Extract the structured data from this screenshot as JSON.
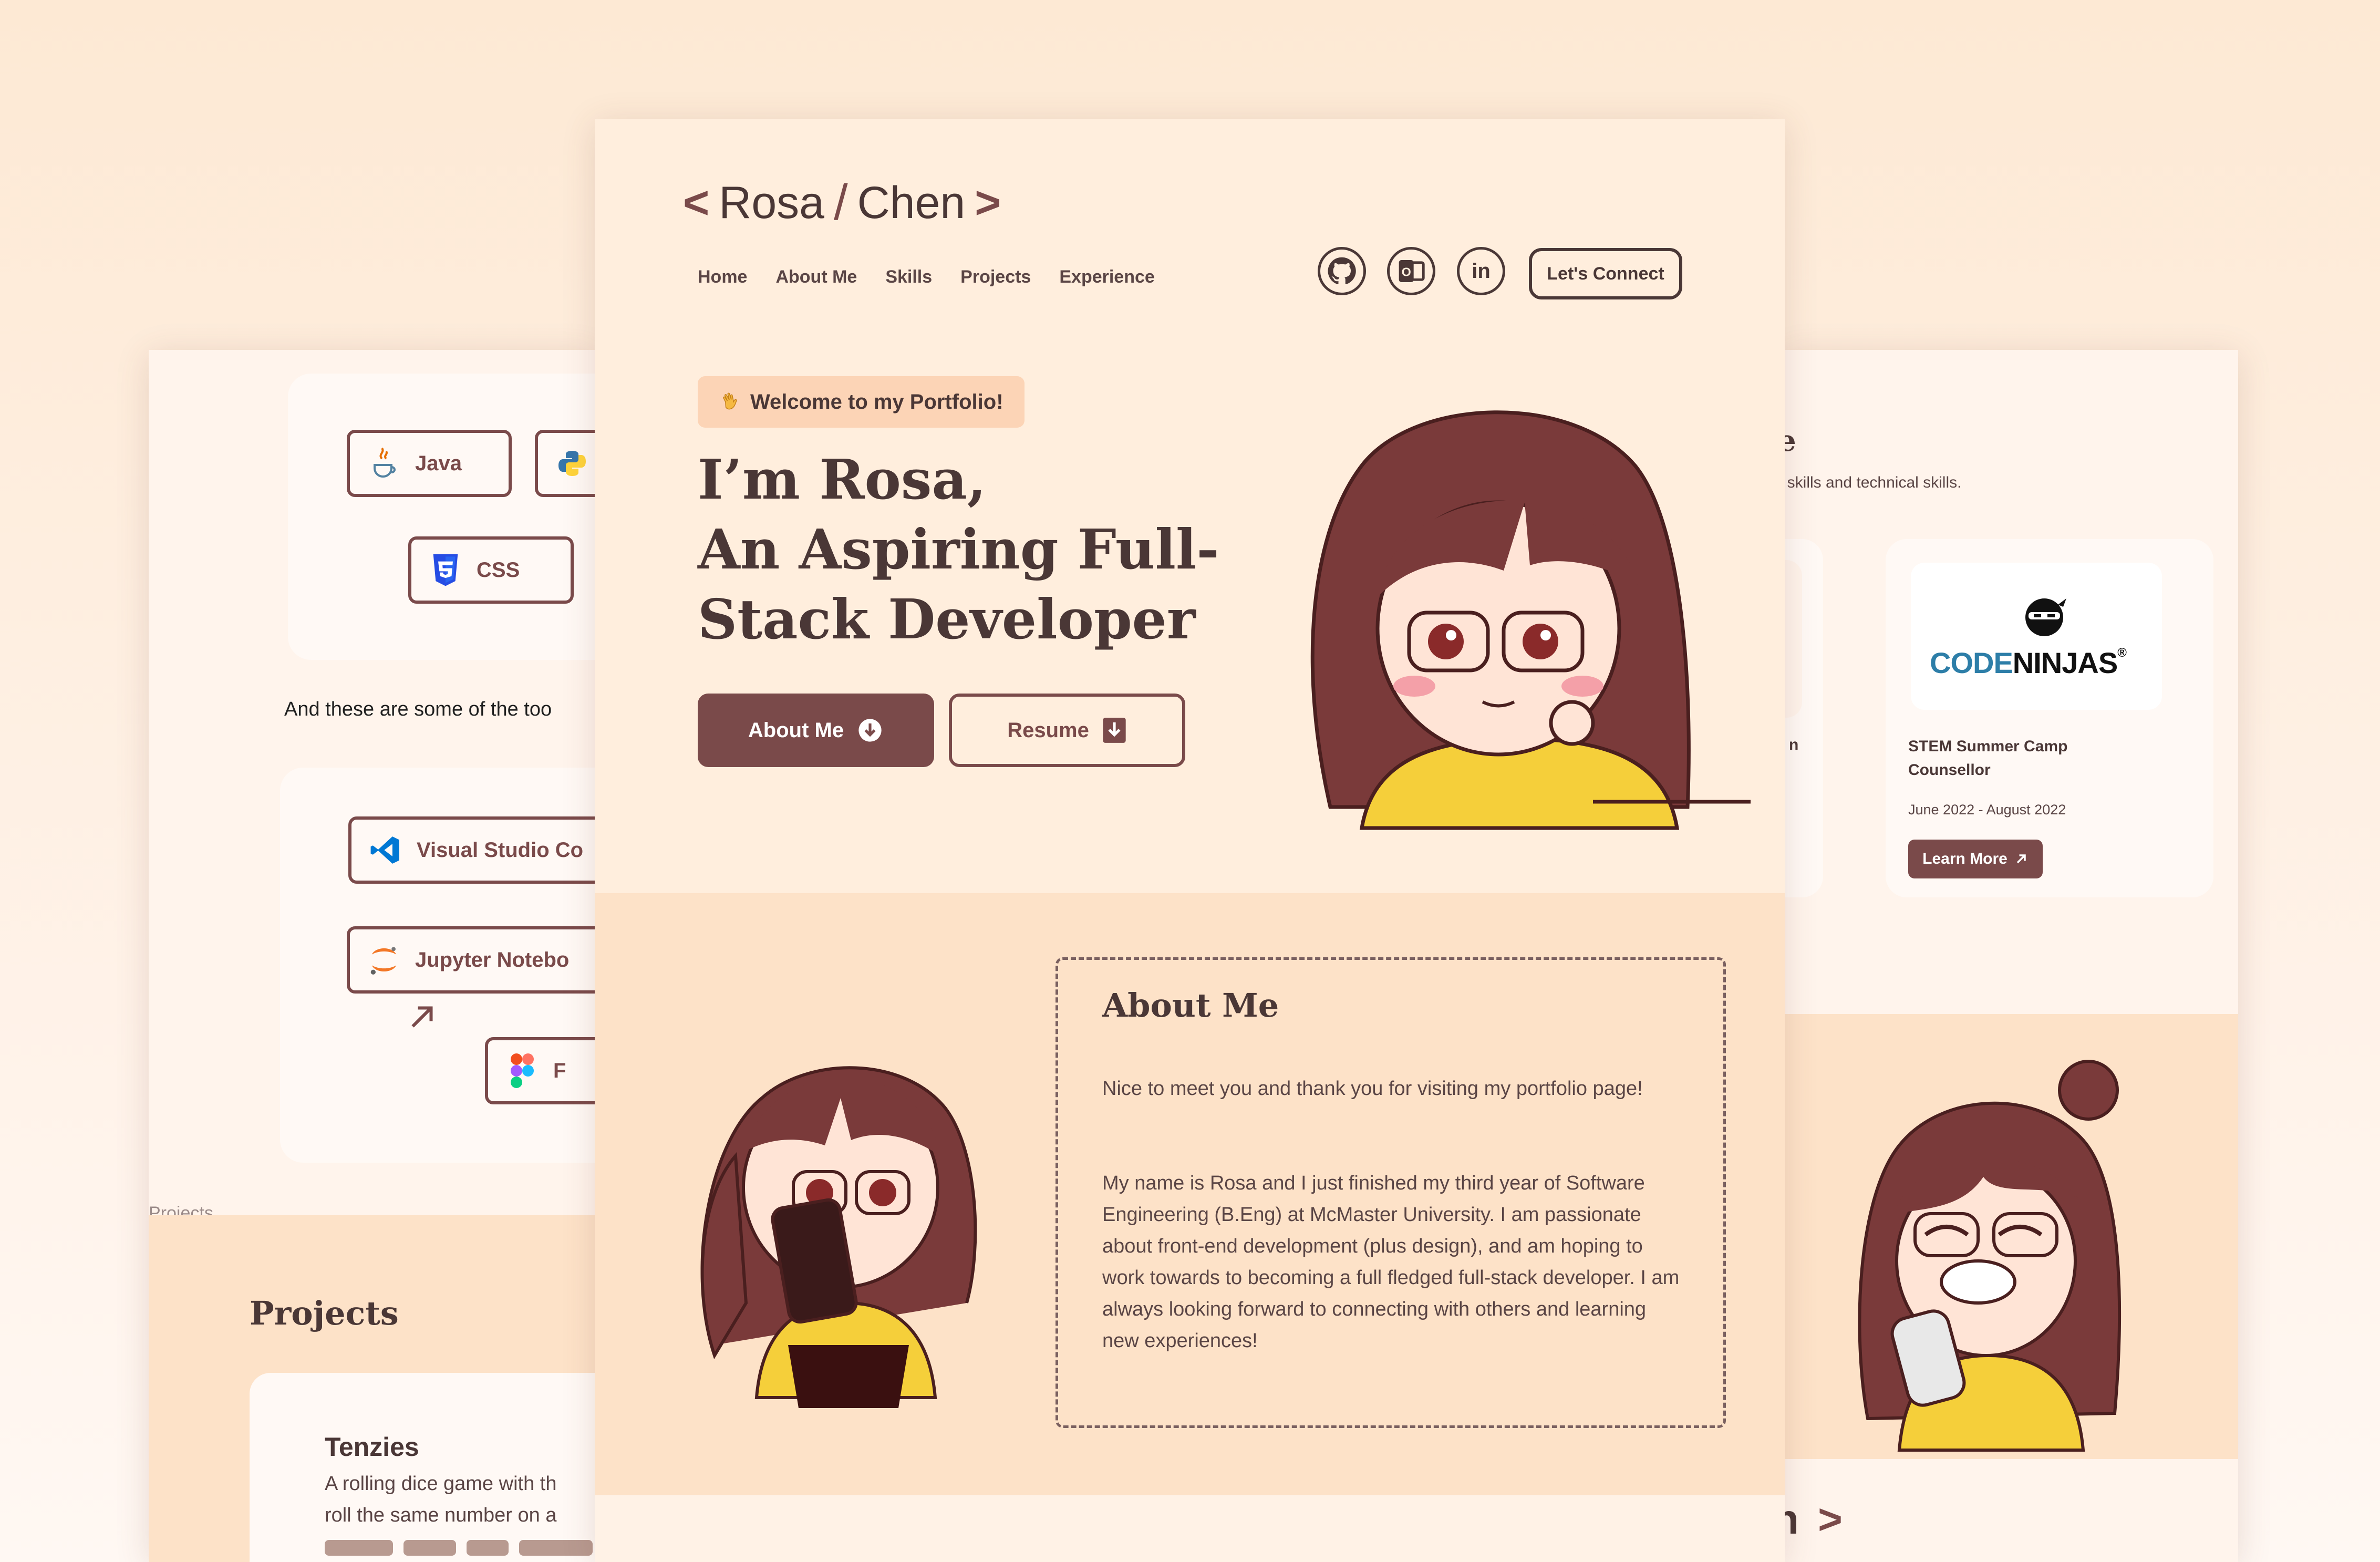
{
  "left_panel": {
    "languages": [
      {
        "label": "Java",
        "icon": "java-icon"
      },
      {
        "label": "CSS",
        "icon": "css-icon"
      }
    ],
    "tools_intro": "And these are some of the too",
    "tools": [
      {
        "label": "Visual Studio Co",
        "icon": "vscode-icon"
      },
      {
        "label": "Jupyter Notebo",
        "icon": "jupyter-icon"
      },
      {
        "label": "F",
        "icon": "figma-icon"
      }
    ],
    "projects_section_label": "Projects",
    "projects_heading": "Projects",
    "project": {
      "title": "Tenzies",
      "description_line1": "A rolling dice game with th",
      "description_line2": "roll the same number on a"
    }
  },
  "main": {
    "logo": {
      "left_bracket": "<",
      "first": "Rosa",
      "slash": "/",
      "last": "Chen",
      "right_bracket": ">"
    },
    "nav": [
      "Home",
      "About Me",
      "Skills",
      "Projects",
      "Experience"
    ],
    "social_icons": [
      "github-icon",
      "outlook-icon",
      "linkedin-icon"
    ],
    "social_glyphs": {
      "outlook": "O",
      "linkedin": "in"
    },
    "connect_label": "Let's Connect",
    "welcome_badge": "Welcome to my Portfolio!",
    "hero_line1": "I’m Rosa,",
    "hero_line2": "An Aspiring Full-",
    "hero_line3": "Stack Developer",
    "about_button": "About Me",
    "resume_button": "Resume",
    "about": {
      "title": "About Me",
      "p1": "Nice to meet you and thank you for visiting my portfolio page!",
      "p2": "My name is Rosa and I just finished my third year of Software Engineering (B.Eng) at McMaster University. I am passionate about front-end development (plus design), and am hoping to work towards to becoming a full fledged full-stack developer. I am always looking forward to connecting with others and learning new experiences!"
    }
  },
  "right_panel": {
    "heading_fragment": "e",
    "subtitle_fragment": "t skills and technical skills.",
    "partial_card_fragment": "n",
    "card": {
      "logo_text_1": "CODE",
      "logo_text_2": "NINJAS",
      "logo_mark": "®",
      "role": "STEM Summer Camp Counsellor",
      "dates": "June 2022 - August 2022",
      "button": "Learn More"
    },
    "footer_fragment": "n",
    "footer_bracket": ">"
  },
  "colors": {
    "accent": "#7a4a4a",
    "text": "#4a3736",
    "badge": "#fcd4b6",
    "section": "#fde2c8"
  }
}
